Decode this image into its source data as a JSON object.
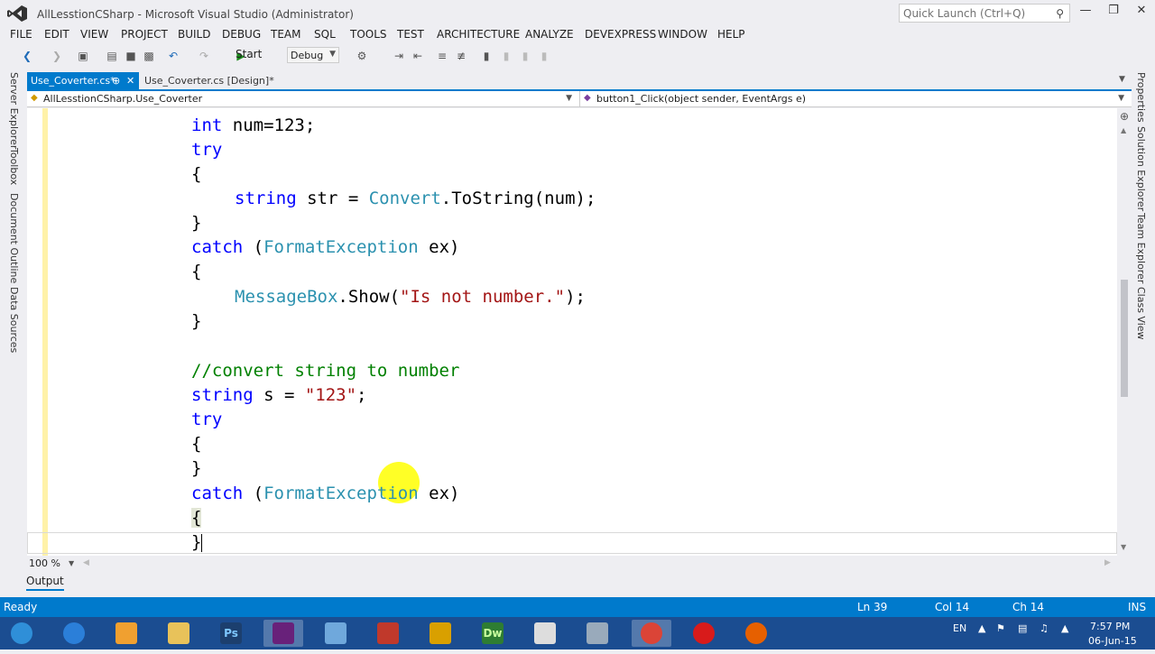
{
  "window": {
    "title": "AllLesstionCSharp - Microsoft Visual Studio (Administrator)",
    "quick_launch_placeholder": "Quick Launch (Ctrl+Q)"
  },
  "menu": [
    "FILE",
    "EDIT",
    "VIEW",
    "PROJECT",
    "BUILD",
    "DEBUG",
    "TEAM",
    "SQL",
    "TOOLS",
    "TEST",
    "ARCHITECTURE",
    "ANALYZE",
    "DEVEXPRESS",
    "WINDOW",
    "HELP"
  ],
  "toolbar": {
    "start_label": "Start",
    "config_label": "Debug"
  },
  "left_rail": [
    "Server Explorer",
    "Toolbox",
    "Document Outline",
    "Data Sources"
  ],
  "right_rail": [
    "Properties",
    "Solution Explorer",
    "Team Explorer",
    "Class View"
  ],
  "tabs": {
    "active": "Use_Coverter.cs*",
    "inactive": "Use_Coverter.cs [Design]*"
  },
  "navbar": {
    "left": "AllLesstionCSharp.Use_Coverter",
    "right": "button1_Click(object sender, EventArgs e)"
  },
  "code": {
    "l1_kw": "int",
    "l1_rest": " num=123;",
    "l2_kw": "try",
    "l3": "{",
    "l4_kw": "string",
    "l4_a": " str = ",
    "l4_ty": "Convert",
    "l4_b": ".ToString(num);",
    "l5": "}",
    "l6_kw": "catch",
    "l6_a": " (",
    "l6_ty": "FormatException",
    "l6_b": " ex)",
    "l7": "{",
    "l8_ty": "MessageBox",
    "l8_a": ".Show(",
    "l8_st": "\"Is not number.\"",
    "l8_b": ");",
    "l9": "}",
    "l10_cm": "//convert string to number",
    "l11_kw": "string",
    "l11_a": " s = ",
    "l11_st": "\"123\"",
    "l11_b": ";",
    "l12_kw": "try",
    "l13": "{",
    "l14": "}",
    "l15_kw": "catch",
    "l15_a": " (",
    "l15_ty": "FormatException",
    "l15_b": " ex)",
    "l16": "{",
    "l17": "}"
  },
  "zoom": "100 %",
  "output_tab": "Output",
  "status": {
    "left": "Ready",
    "ln": "Ln 39",
    "col": "Col 14",
    "ch": "Ch 14",
    "mode": "INS"
  },
  "tray": {
    "lang": "EN",
    "time": "7:57 PM",
    "date": "06-Jun-15"
  },
  "taskbar_apps": [
    {
      "name": "start-orb-icon",
      "color": "#2f8fd8"
    },
    {
      "name": "internet-explorer-icon",
      "color": "#2b7fd9"
    },
    {
      "name": "media-player-icon",
      "color": "#f0a030"
    },
    {
      "name": "file-explorer-icon",
      "color": "#e8c25a"
    },
    {
      "name": "photoshop-icon",
      "color": "#1c3f6e"
    },
    {
      "name": "visual-studio-icon",
      "color": "#68217a"
    },
    {
      "name": "cube-app-icon",
      "color": "#6fa8dc"
    },
    {
      "name": "eraser-app-icon",
      "color": "#c0392b"
    },
    {
      "name": "paint-tools-icon",
      "color": "#d9a000"
    },
    {
      "name": "dreamweaver-icon",
      "color": "#2e7d32"
    },
    {
      "name": "window-app-icon",
      "color": "#dddddd"
    },
    {
      "name": "network-globe-icon",
      "color": "#9ab"
    },
    {
      "name": "chrome-icon",
      "color": "#db4437"
    },
    {
      "name": "opera-icon",
      "color": "#d81b1b"
    },
    {
      "name": "firefox-icon",
      "color": "#e66000"
    }
  ],
  "taskbar_labels": {
    "ps": "Ps",
    "dw": "Dw"
  }
}
